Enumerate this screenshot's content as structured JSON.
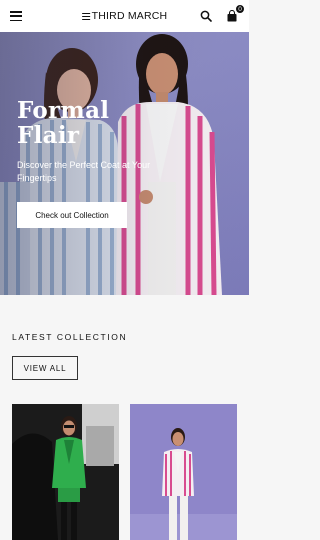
{
  "header": {
    "brand": "THIRD MARCH",
    "menu_icon": "hamburger-menu-icon",
    "search_icon": "search-icon",
    "cart_icon": "shopping-bag-icon",
    "cart_count": "0"
  },
  "hero": {
    "title": "Formal Flair",
    "subtitle": "Discover the Perfect Coat at Your Fingertips",
    "cta_label": "Check out Collection"
  },
  "latest": {
    "heading": "LATEST COLLECTION",
    "view_all_label": "VIEW ALL"
  },
  "products": [
    {
      "image": "green-blazer-outfit"
    },
    {
      "image": "pink-striped-blazer-outfit"
    }
  ],
  "colors": {
    "hero_bg": "#8c8cc4",
    "header_bg": "#ffffff",
    "page_bg": "#f6f6f6",
    "text": "#111111"
  }
}
